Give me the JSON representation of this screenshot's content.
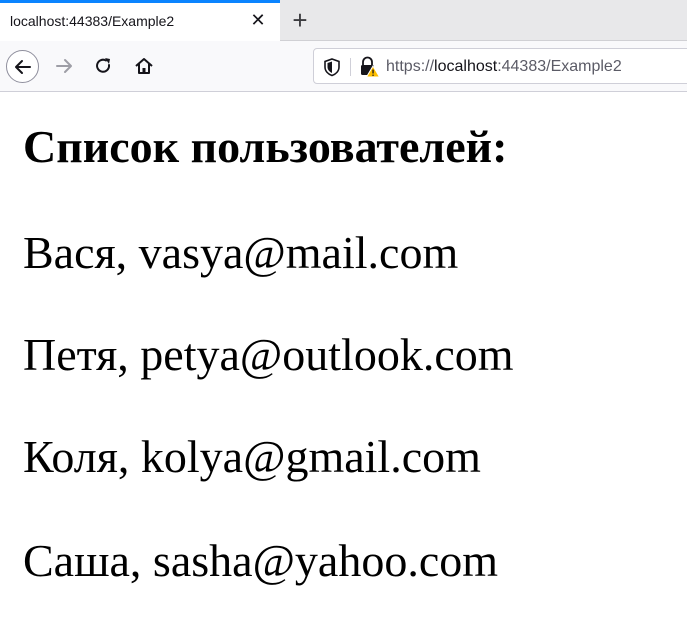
{
  "browser": {
    "tab": {
      "title": "localhost:44383/Example2",
      "close_glyph": "✕"
    },
    "newtab_glyph": "+",
    "address": {
      "scheme": "https://",
      "host": "localhost",
      "rest": ":44383/Example2"
    },
    "icons": {
      "back": "arrow-left-icon",
      "forward": "arrow-right-icon",
      "reload": "reload-icon",
      "home": "home-icon",
      "tracking": "shield-icon",
      "security": "lock-warning-icon"
    },
    "accent_color": "#0a84ff"
  },
  "page": {
    "heading": "Список пользователей:",
    "users": [
      {
        "text": "Вася, vasya@mail.com"
      },
      {
        "text": "Петя, petya@outlook.com"
      },
      {
        "text": "Коля, kolya@gmail.com"
      },
      {
        "text": "Саша, sasha@yahoo.com"
      }
    ]
  }
}
